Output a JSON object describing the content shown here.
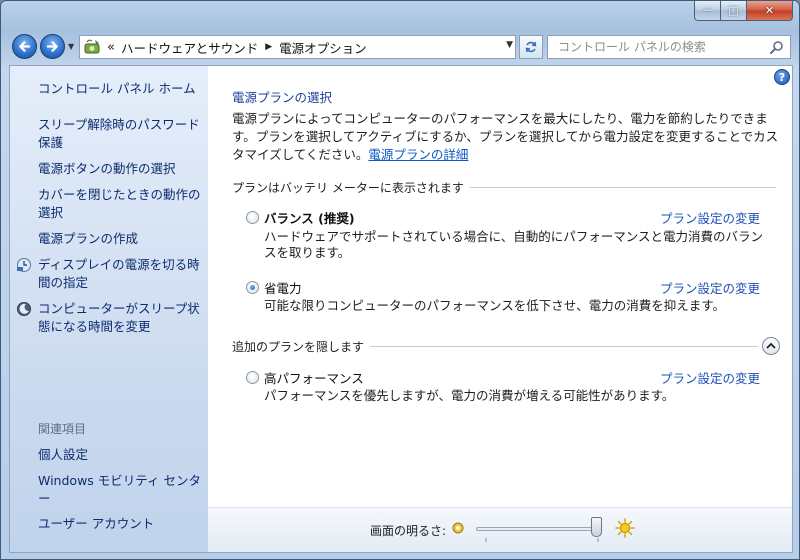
{
  "window": {
    "minimize_glyph": "─",
    "maximize_glyph": "□",
    "close_glyph": "✕"
  },
  "address_bar": {
    "overflow": "«",
    "crumbs": [
      "ハードウェアとサウンド",
      "電源オプション"
    ]
  },
  "search": {
    "placeholder": "コントロール パネルの検索"
  },
  "sidebar": {
    "home": "コントロール パネル ホーム",
    "links": [
      "スリープ解除時のパスワード保護",
      "電源ボタンの動作の選択",
      "カバーを閉じたときの動作の選択",
      "電源プランの作成",
      "ディスプレイの電源を切る時間の指定",
      "コンピューターがスリープ状態になる時間を変更"
    ],
    "related_heading": "関連項目",
    "related": [
      "個人設定",
      "Windows モビリティ センター",
      "ユーザー アカウント"
    ]
  },
  "main": {
    "title": "電源プランの選択",
    "description": "電源プランによってコンピューターのパフォーマンスを最大にしたり、電力を節約したりできます。プランを選択してアクティブにするか、プランを選択してから電力設定を変更することでカスタマイズしてください。",
    "description_link": "電源プランの詳細",
    "section_battery": "プランはバッテリ メーターに表示されます",
    "section_additional": "追加のプランを隠します",
    "change_settings": "プラン設定の変更",
    "plans": [
      {
        "name": "バランス (推奨)",
        "desc": "ハードウェアでサポートされている場合に、自動的にパフォーマンスと電力消費のバランスを取ります。",
        "selected": false
      },
      {
        "name": "省電力",
        "desc": "可能な限りコンピューターのパフォーマンスを低下させ、電力の消費を抑えます。",
        "selected": true
      },
      {
        "name": "高パフォーマンス",
        "desc": "パフォーマンスを優先しますが、電力の消費が増える可能性があります。",
        "selected": false
      }
    ]
  },
  "brightness": {
    "label": "画面の明るさ:",
    "level": 1.0
  }
}
